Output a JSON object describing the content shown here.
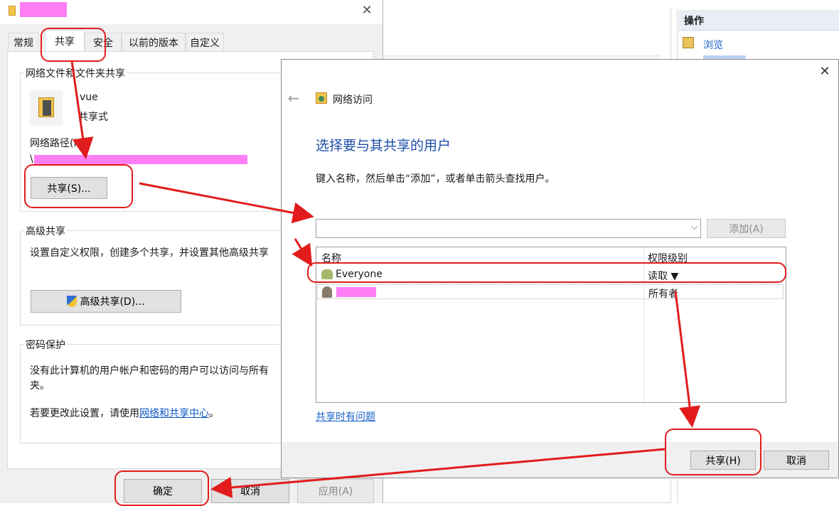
{
  "props": {
    "tabs": [
      "常规",
      "共享",
      "安全",
      "以前的版本",
      "自定义"
    ],
    "network_section": {
      "title": "网络文件和文件夹共享",
      "folder_name": "vue",
      "folder_status": "共享式",
      "path_label": "网络路径(N):",
      "path_value": "\\",
      "share_button": "共享(S)..."
    },
    "advanced_section": {
      "title": "高级共享",
      "description": "设置自定义权限，创建多个共享，并设置其他高级共享",
      "button": "高级共享(D)..."
    },
    "password_section": {
      "title": "密码保护",
      "line1": "没有此计算机的用户帐户和密码的用户可以访问与所有",
      "line2": "夹。",
      "line3_prefix": "若要更改此设置，请使用",
      "line3_link": "网络和共享中心",
      "line3_suffix": "。"
    },
    "footer": {
      "ok": "确定",
      "cancel": "取消",
      "apply": "应用(A)"
    }
  },
  "right_panel": {
    "title": "操作",
    "browse": "浏览"
  },
  "dialog": {
    "header_title": "网络访问",
    "heading": "选择要与其共享的用户",
    "instruction": "键入名称，然后单击“添加”，或者单击箭头查找用户。",
    "input_value": "",
    "add_button": "添加(A)",
    "columns": {
      "name": "名称",
      "level": "权限级别"
    },
    "rows": [
      {
        "name": "Everyone",
        "level": "读取 ▼"
      },
      {
        "name": "",
        "level": "所有者"
      }
    ],
    "help_link": "共享时有问题",
    "share_button": "共享(H)",
    "cancel_button": "取消"
  },
  "colors": {
    "accent_title": "#1e4fa8",
    "annotation": "#e21c1c",
    "redaction": "#ff7ef5"
  }
}
